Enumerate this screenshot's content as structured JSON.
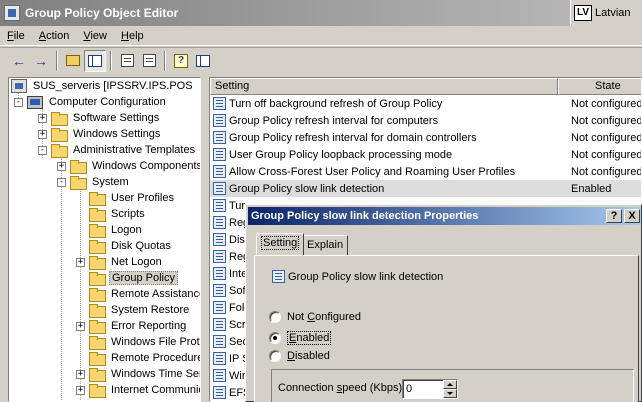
{
  "window": {
    "title": "Group Policy Object Editor"
  },
  "language": {
    "code": "LV",
    "name": "Latvian"
  },
  "menu": {
    "file": {
      "acc": "F",
      "rest": "ile"
    },
    "action": {
      "acc": "A",
      "rest": "ction"
    },
    "view": {
      "acc": "V",
      "rest": "iew"
    },
    "help": {
      "acc": "H",
      "rest": "elp"
    }
  },
  "tree": [
    {
      "label": "SUS_serveris [IPSSRV.IPS.POS",
      "icon": "gpo-icon"
    },
    {
      "label": "Computer Configuration",
      "icon": "computer-icon",
      "exp": "-"
    },
    {
      "label": "Software Settings",
      "icon": "folder-icon",
      "exp": "+"
    },
    {
      "label": "Windows Settings",
      "icon": "folder-icon",
      "exp": "+"
    },
    {
      "label": "Administrative Templates",
      "icon": "folder-icon",
      "exp": "-"
    },
    {
      "label": "Windows Components",
      "icon": "folder-icon",
      "exp": "+"
    },
    {
      "label": "System",
      "icon": "folder-icon",
      "exp": "-"
    },
    {
      "label": "User Profiles",
      "icon": "folder-icon"
    },
    {
      "label": "Scripts",
      "icon": "folder-icon"
    },
    {
      "label": "Logon",
      "icon": "folder-icon"
    },
    {
      "label": "Disk Quotas",
      "icon": "folder-icon"
    },
    {
      "label": "Net Logon",
      "icon": "folder-icon",
      "exp": "+"
    },
    {
      "label": "Group Policy",
      "icon": "folder-icon",
      "selected": true
    },
    {
      "label": "Remote Assistance",
      "icon": "folder-icon"
    },
    {
      "label": "System Restore",
      "icon": "folder-icon"
    },
    {
      "label": "Error Reporting",
      "icon": "folder-icon",
      "exp": "+"
    },
    {
      "label": "Windows File Protection",
      "icon": "folder-icon"
    },
    {
      "label": "Remote Procedure Call",
      "icon": "folder-icon"
    },
    {
      "label": "Windows Time Service",
      "icon": "folder-icon",
      "exp": "+"
    },
    {
      "label": "Internet Communication",
      "icon": "folder-icon",
      "exp": "+"
    }
  ],
  "list": {
    "headers": {
      "setting": "Setting",
      "state": "State"
    },
    "rows": [
      {
        "setting": "Turn off background refresh of Group Policy",
        "state": "Not configured"
      },
      {
        "setting": "Group Policy refresh interval for computers",
        "state": "Not configured"
      },
      {
        "setting": "Group Policy refresh interval for domain controllers",
        "state": "Not configured"
      },
      {
        "setting": "User Group Policy loopback processing mode",
        "state": "Not configured"
      },
      {
        "setting": "Allow Cross-Forest User Policy and Roaming User Profiles",
        "state": "Not configured"
      },
      {
        "setting": "Group Policy slow link detection",
        "state": "Enabled",
        "selected": true
      },
      {
        "setting": "Tur",
        "state": ""
      },
      {
        "setting": "Reg",
        "state": ""
      },
      {
        "setting": "Dis",
        "state": ""
      },
      {
        "setting": "Reg",
        "state": ""
      },
      {
        "setting": "Inte",
        "state": ""
      },
      {
        "setting": "Sof",
        "state": ""
      },
      {
        "setting": "Fold",
        "state": ""
      },
      {
        "setting": "Scri",
        "state": ""
      },
      {
        "setting": "Sec",
        "state": ""
      },
      {
        "setting": "IP S",
        "state": ""
      },
      {
        "setting": "Wir",
        "state": ""
      },
      {
        "setting": "EFS",
        "state": ""
      }
    ]
  },
  "dialog": {
    "title": "Group Policy slow link detection Properties",
    "help_btn": "?",
    "close_btn": "X",
    "tabs": [
      "Setting",
      "Explain"
    ],
    "policy_name": "Group Policy slow link detection",
    "options": {
      "not_configured": {
        "pre": "Not ",
        "acc": "C",
        "post": "onfigured"
      },
      "enabled": {
        "pre": "",
        "acc": "E",
        "post": "nabled"
      },
      "disabled": {
        "pre": "",
        "acc": "D",
        "post": "isabled"
      }
    },
    "selected_option": "enabled",
    "speed": {
      "pre": "Connection ",
      "acc": "s",
      "post": "peed (Kbps):",
      "value": "0"
    }
  }
}
